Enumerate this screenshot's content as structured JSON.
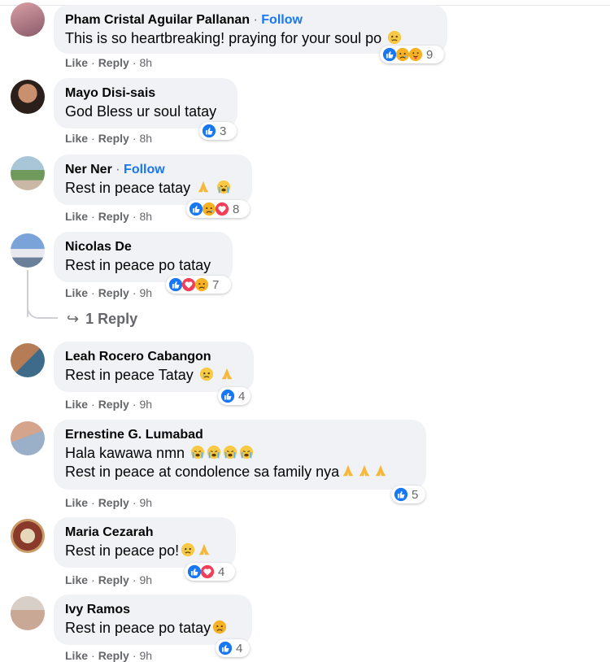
{
  "comments": [
    {
      "author": "Pham Cristal Aguilar Pallanan",
      "dot": "·",
      "follow": "Follow",
      "lines": [
        "This is so heartbreaking! praying for your soul po"
      ],
      "like": "Like",
      "reply": "Reply",
      "time": "8h",
      "reactions": [
        "like",
        "sad",
        "care"
      ],
      "count": "9"
    },
    {
      "author": "Mayo Disi-sais",
      "lines": [
        "God Bless ur soul tatay"
      ],
      "like": "Like",
      "reply": "Reply",
      "time": "8h",
      "reactions": [
        "like"
      ],
      "count": "3"
    },
    {
      "author": "Ner Ner",
      "dot": "·",
      "follow": "Follow",
      "lines": [
        "Rest in peace tatay"
      ],
      "like": "Like",
      "reply": "Reply",
      "time": "8h",
      "reactions": [
        "like",
        "sad",
        "love"
      ],
      "count": "8"
    },
    {
      "author": "Nicolas De",
      "lines": [
        "Rest in peace po tatay"
      ],
      "like": "Like",
      "reply": "Reply",
      "time": "9h",
      "reactions": [
        "like",
        "love",
        "sad"
      ],
      "count": "7"
    },
    {
      "author": "Leah Rocero Cabangon",
      "lines": [
        "Rest in peace Tatay"
      ],
      "like": "Like",
      "reply": "Reply",
      "time": "9h",
      "reactions": [
        "like"
      ],
      "count": "4"
    },
    {
      "author": "Ernestine G. Lumabad",
      "lines": [
        "Hala kawawa nmn",
        "Rest in peace at condolence sa family nya"
      ],
      "like": "Like",
      "reply": "Reply",
      "time": "9h",
      "reactions": [
        "like"
      ],
      "count": "5"
    },
    {
      "author": "Maria Cezarah",
      "lines": [
        "Rest in peace po!"
      ],
      "like": "Like",
      "reply": "Reply",
      "time": "9h",
      "reactions": [
        "like",
        "love"
      ],
      "count": "4"
    },
    {
      "author": "Ivy Ramos",
      "lines": [
        "Rest in peace po tatay"
      ],
      "like": "Like",
      "reply": "Reply",
      "time": "9h",
      "reactions": [
        "like"
      ],
      "count": "4"
    }
  ],
  "replies_link": {
    "arrow": "↪",
    "label": "1 Reply"
  },
  "colors": {
    "link": "#1877f2",
    "meta": "#65676b",
    "bubble": "#f0f2f5",
    "like": "#1877f2",
    "love": "#f33e58",
    "sad": "#f7b125"
  },
  "icons": {
    "like": "thumbs-up-icon",
    "love": "heart-icon",
    "sad": "sad-face-icon",
    "care": "care-face-icon",
    "cry": "crying-face-icon",
    "pray": "praying-hands-icon",
    "teary": "teary-face-icon"
  }
}
